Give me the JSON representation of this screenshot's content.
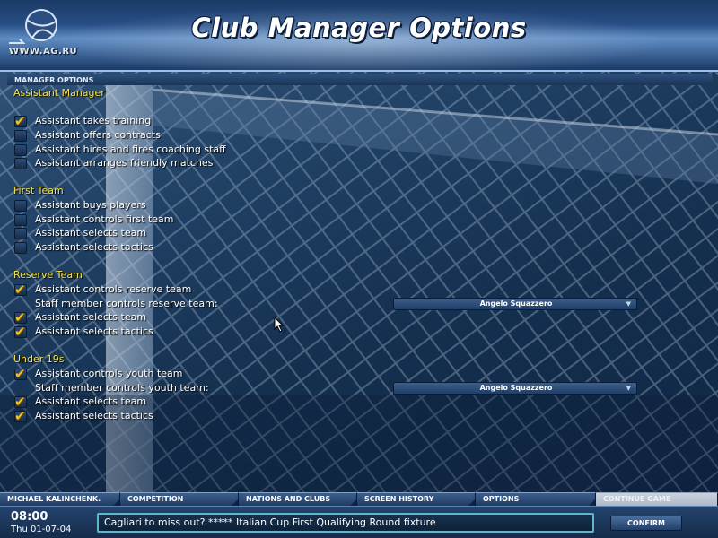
{
  "header": {
    "title": "Club Manager Options",
    "logo_text": "WWW.AG.RU"
  },
  "section": {
    "label": "MANAGER OPTIONS"
  },
  "groups": [
    {
      "heading": "Assistant Manager",
      "options": [
        {
          "label": "Assistant takes training",
          "checked": true
        },
        {
          "label": "Assistant offers contracts",
          "checked": false
        },
        {
          "label": "Assistant hires and fires coaching staff",
          "checked": false
        },
        {
          "label": "Assistant arranges friendly matches",
          "checked": false
        }
      ]
    },
    {
      "heading": "First Team",
      "options": [
        {
          "label": "Assistant buys players",
          "checked": false
        },
        {
          "label": "Assistant controls first team",
          "checked": false
        },
        {
          "label": "Assistant selects team",
          "checked": false
        },
        {
          "label": "Assistant selects tactics",
          "checked": false
        }
      ]
    },
    {
      "heading": "Reserve Team",
      "options": [
        {
          "label": "Assistant controls reserve team",
          "checked": true
        },
        {
          "label": "Assistant selects team",
          "checked": true
        },
        {
          "label": "Assistant selects tactics",
          "checked": true
        }
      ],
      "staff": {
        "label": "Staff member controls reserve team:",
        "value": "Angelo Squazzero"
      }
    },
    {
      "heading": "Under 19s",
      "options": [
        {
          "label": "Assistant controls youth team",
          "checked": true
        },
        {
          "label": "Assistant selects team",
          "checked": true
        },
        {
          "label": "Assistant selects tactics",
          "checked": true
        }
      ],
      "staff": {
        "label": "Staff member controls youth team:",
        "value": "Angelo Squazzero"
      }
    }
  ],
  "tabs": [
    {
      "label": "MICHAEL KALINCHENK.",
      "enabled": true
    },
    {
      "label": "COMPETITION",
      "enabled": true
    },
    {
      "label": "NATIONS AND CLUBS",
      "enabled": true
    },
    {
      "label": "SCREEN HISTORY",
      "enabled": true
    },
    {
      "label": "OPTIONS",
      "enabled": true
    },
    {
      "label": "CONTINUE GAME",
      "enabled": false
    }
  ],
  "status": {
    "time": "08:00",
    "date": "Thu 01-07-04",
    "news": "Cagliari to miss out? ***** Italian Cup First Qualifying Round fixture",
    "confirm_label": "CONFIRM"
  },
  "colors": {
    "heading": "#f3e34a",
    "tick": "#f2c21b",
    "ticker_border": "#5fb7c9"
  }
}
